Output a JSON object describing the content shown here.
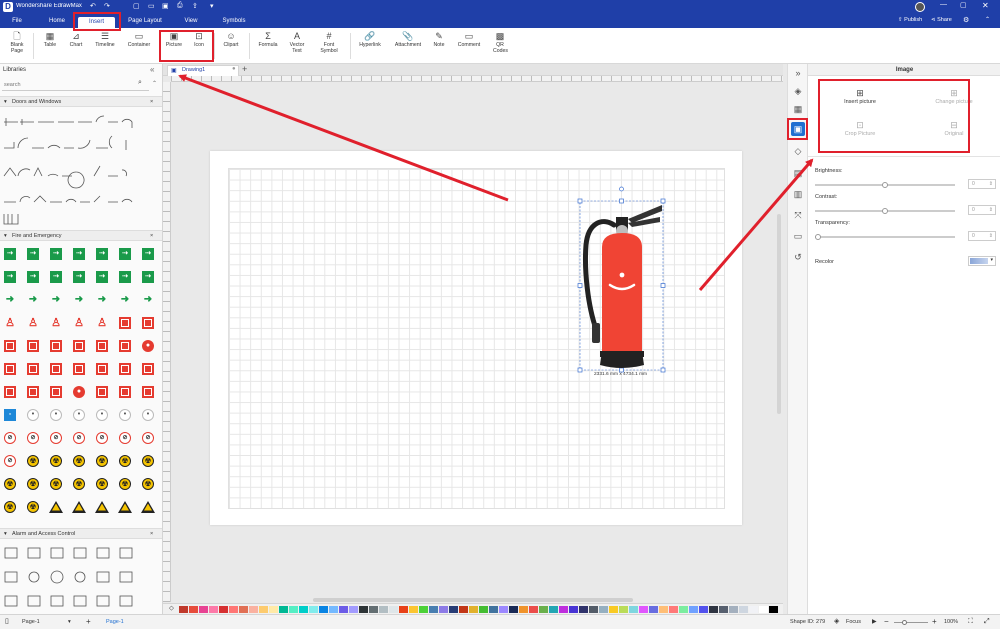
{
  "window": {
    "title": "Wondershare EdrawMax"
  },
  "account": {
    "publish": "Publish",
    "share": "Share"
  },
  "menu": {
    "tabs": [
      {
        "label": "File"
      },
      {
        "label": "Home"
      },
      {
        "label": "Insert"
      },
      {
        "label": "Page Layout"
      },
      {
        "label": "View"
      },
      {
        "label": "Symbols"
      }
    ]
  },
  "ribbon": {
    "blank_page": "Blank Page",
    "table": "Table",
    "chart": "Chart",
    "timeline": "Timeline",
    "container": "Container",
    "picture": "Picture",
    "icon": "Icon",
    "clipart": "Clipart",
    "formula": "Formula",
    "vector_text": "Vector Text",
    "font_symbol": "Font Symbol",
    "hyperlink": "Hyperlink",
    "attachment": "Attachment",
    "note": "Note",
    "comment": "Comment",
    "qr_codes": "QR Codes"
  },
  "libraries": {
    "title": "Libraries",
    "search_placeholder": "search",
    "sections": [
      {
        "title": "Doors and Windows"
      },
      {
        "title": "Fire and Emergency"
      },
      {
        "title": "Alarm and Access Control"
      }
    ]
  },
  "doc": {
    "tab_name": "Drawing1"
  },
  "shape": {
    "dimension_label": "2331.6 mm x 4734.1 mm"
  },
  "props": {
    "header": "Image",
    "insert_picture": "Insert picture",
    "change_picture": "Change picture",
    "crop_picture": "Crop Picture",
    "original": "Original",
    "brightness": "Brightness:",
    "contrast": "Contrast:",
    "transparency": "Transparency:",
    "recolor": "Recolor",
    "brightness_value": "0",
    "contrast_value": "0",
    "transparency_value": "0",
    "brightness_level": 0.5,
    "contrast_level": 0.5,
    "transparency_level": 0.0
  },
  "status": {
    "page_dropdown": "Page-1",
    "page_tab": "Page-1",
    "shape_id": "Shape ID: 279",
    "focus": "Focus",
    "zoom": "100%"
  },
  "colors": {
    "accent": "#1f3fa8",
    "highlight": "#e0202c",
    "extinguisher": "#f04434",
    "emergency_green": "#1a9a4a",
    "fire_red": "#e53b30",
    "warning_yellow": "#f5c400"
  }
}
